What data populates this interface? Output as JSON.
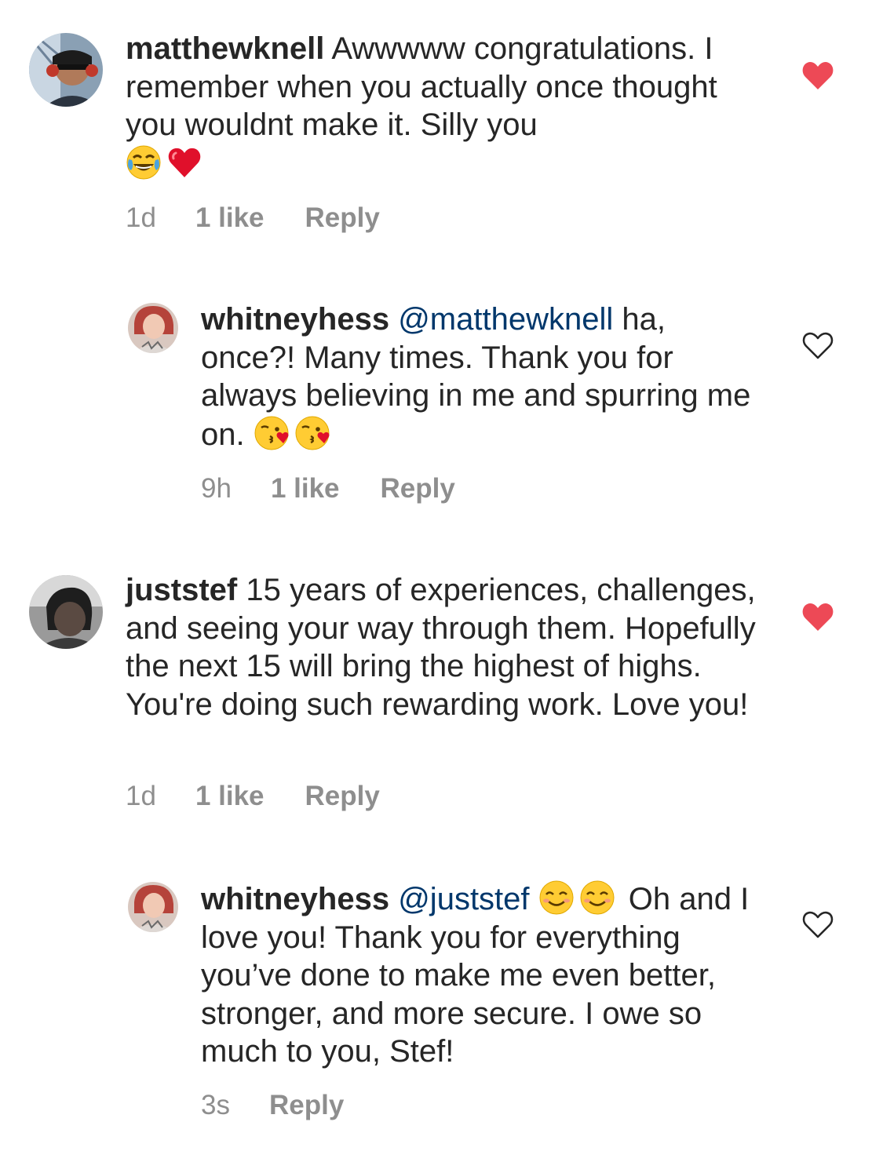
{
  "comments": [
    {
      "username": "matthewknell",
      "mention": "",
      "body": "Awwwww congratulations. I remember when you actually once thought you wouldnt make it.  Silly you",
      "trailing_emojis": [
        "face-with-tears-of-joy-icon",
        "red-heart-icon"
      ],
      "time": "1d",
      "likes": "1 like",
      "reply": "Reply",
      "liked": true
    },
    {
      "username": "whitneyhess",
      "mention": "@matthewknell",
      "body": "ha, once?! Many times. Thank you for always believing in me and spurring me on.",
      "trailing_emojis": [
        "face-blowing-kiss-icon",
        "face-blowing-kiss-icon"
      ],
      "time": "9h",
      "likes": "1 like",
      "reply": "Reply",
      "liked": false
    },
    {
      "username": "juststef",
      "mention": "",
      "body": "15 years of experiences, challenges, and seeing your way through them.  Hopefully the next 15 will bring the highest of highs.  You're doing such rewarding work.  Love you!",
      "trailing_emojis": [],
      "time": "1d",
      "likes": "1 like",
      "reply": "Reply",
      "liked": true
    },
    {
      "username": "whitneyhess",
      "mention": "@juststef",
      "inline_emojis": [
        "smiling-face-icon",
        "smiling-face-icon"
      ],
      "body": "Oh and I love you! Thank you for everything you’ve done to make me even better, stronger, and more secure. I owe so much to you, Stef!",
      "trailing_emojis": [],
      "time": "3s",
      "likes": "",
      "reply": "Reply",
      "liked": false
    }
  ],
  "colors": {
    "text": "#262626",
    "meta": "#8e8e8e",
    "mention": "#00376b",
    "liked_heart": "#ed4956",
    "unliked_heart": "#262626"
  }
}
